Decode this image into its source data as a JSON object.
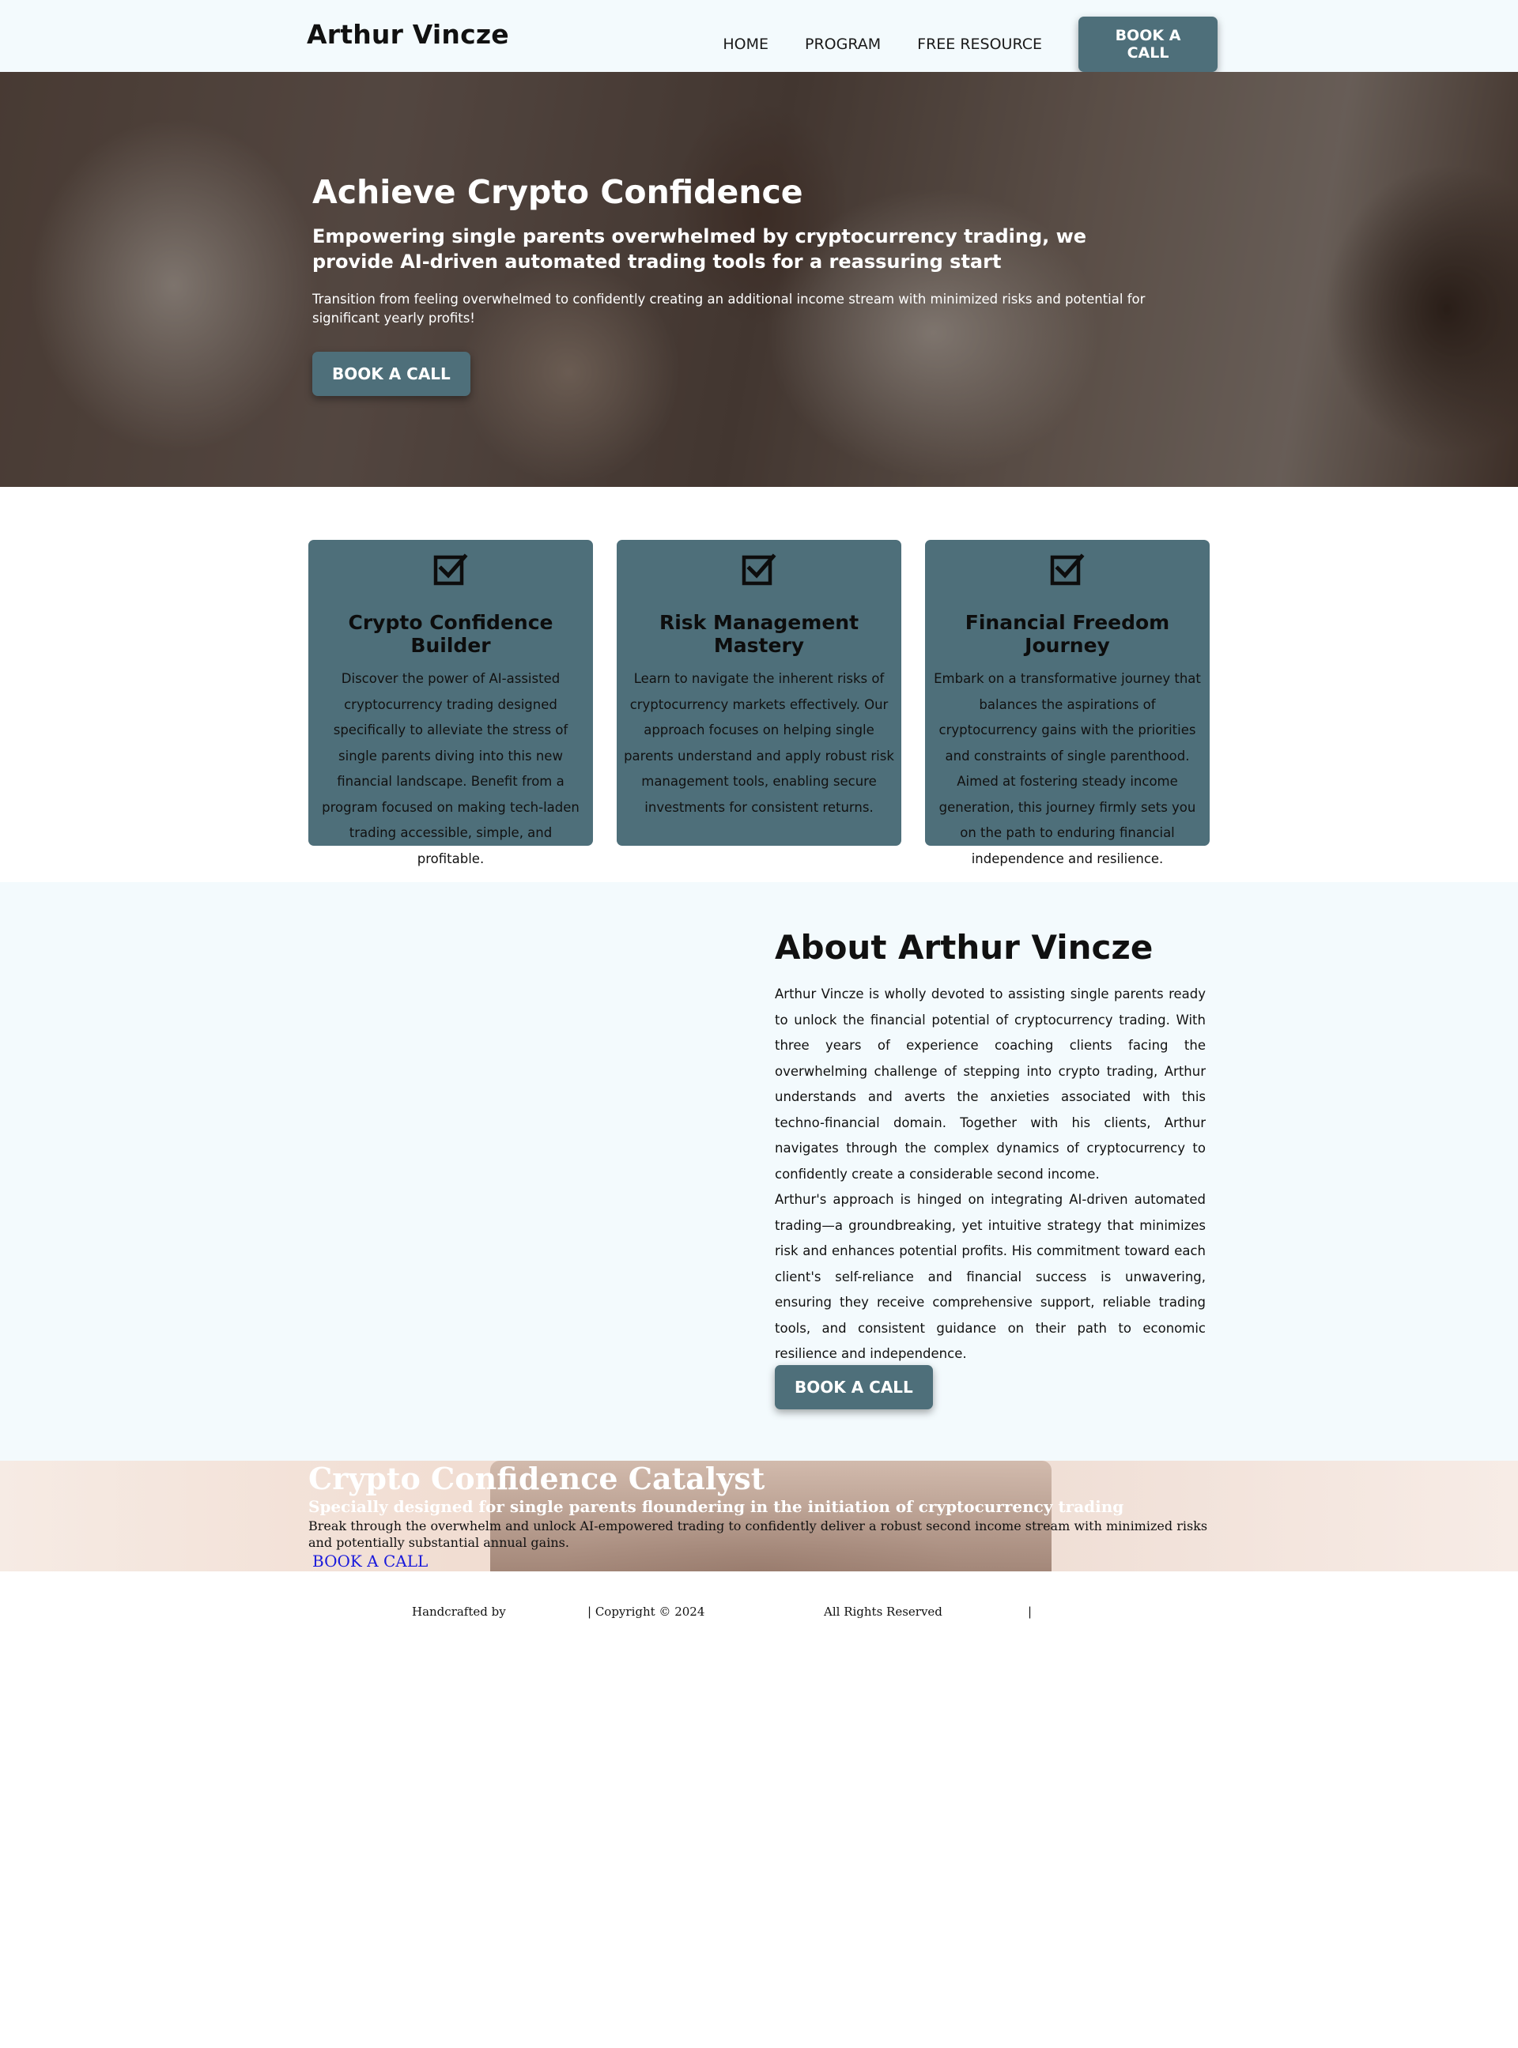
{
  "header": {
    "brand": "Arthur Vincze",
    "nav": [
      "HOME",
      "PROGRAM",
      "FREE RESOURCE"
    ],
    "cta": "BOOK A CALL"
  },
  "hero": {
    "title": "Achieve Crypto Confidence",
    "subtitle": "Empowering single parents overwhelmed by cryptocurrency trading, we provide AI-driven automated trading tools for a reassuring start",
    "text": "Transition from feeling overwhelmed to confidently creating an additional income stream with minimized risks and potential for significant yearly profits!",
    "cta": "BOOK A CALL"
  },
  "features": [
    {
      "title": "Crypto Confidence Builder",
      "text": "Discover the power of AI-assisted cryptocurrency trading designed specifically to alleviate the stress of single parents diving into this new financial landscape. Benefit from a program focused on making tech-laden trading accessible, simple, and profitable."
    },
    {
      "title": "Risk Management Mastery",
      "text": "Learn to navigate the inherent risks of cryptocurrency markets effectively. Our approach focuses on helping single parents understand and apply robust risk management tools, enabling secure investments for consistent returns."
    },
    {
      "title": "Financial Freedom Journey",
      "text": "Embark on a transformative journey that balances the aspirations of cryptocurrency gains with the priorities and constraints of single parenthood. Aimed at fostering steady income generation, this journey firmly sets you on the path to enduring financial independence and resilience."
    }
  ],
  "about": {
    "title": "About Arthur Vincze",
    "paragraphs": [
      "Arthur Vincze is wholly devoted to assisting single parents ready to unlock the financial potential of cryptocurrency trading. With three years of experience coaching clients facing the overwhelming challenge of stepping into crypto trading, Arthur understands and averts the anxieties associated with this techno-financial domain. Together with his clients, Arthur navigates through the complex dynamics of cryptocurrency to confidently create a considerable second income.",
      "Arthur's approach is hinged on integrating AI-driven automated trading—a groundbreaking, yet intuitive strategy that minimizes risk and enhances potential profits. His commitment toward each client's self-reliance and financial success is unwavering, ensuring they receive comprehensive support, reliable trading tools, and consistent guidance on their path to economic resilience and independence."
    ],
    "cta": "BOOK A CALL"
  },
  "catalyst": {
    "title": "Crypto Confidence Catalyst",
    "subtitle": "Specially designed for single parents floundering in the initiation of cryptocurrency trading",
    "text": "Break through the overwhelm and unlock AI-empowered trading to confidently deliver a robust second income stream with minimized risks and potentially substantial annual gains.",
    "cta": "BOOK A CALL"
  },
  "footer": {
    "handcrafted": "Handcrafted by",
    "copyright": "| Copyright © 2024",
    "rights": "All Rights Reserved",
    "sep": "|"
  },
  "colors": {
    "accent": "#4e6f7a",
    "header_bg": "#f3fafd",
    "link": "#1a1adb"
  },
  "icons": {
    "feature": "checkbox-checked-icon"
  }
}
